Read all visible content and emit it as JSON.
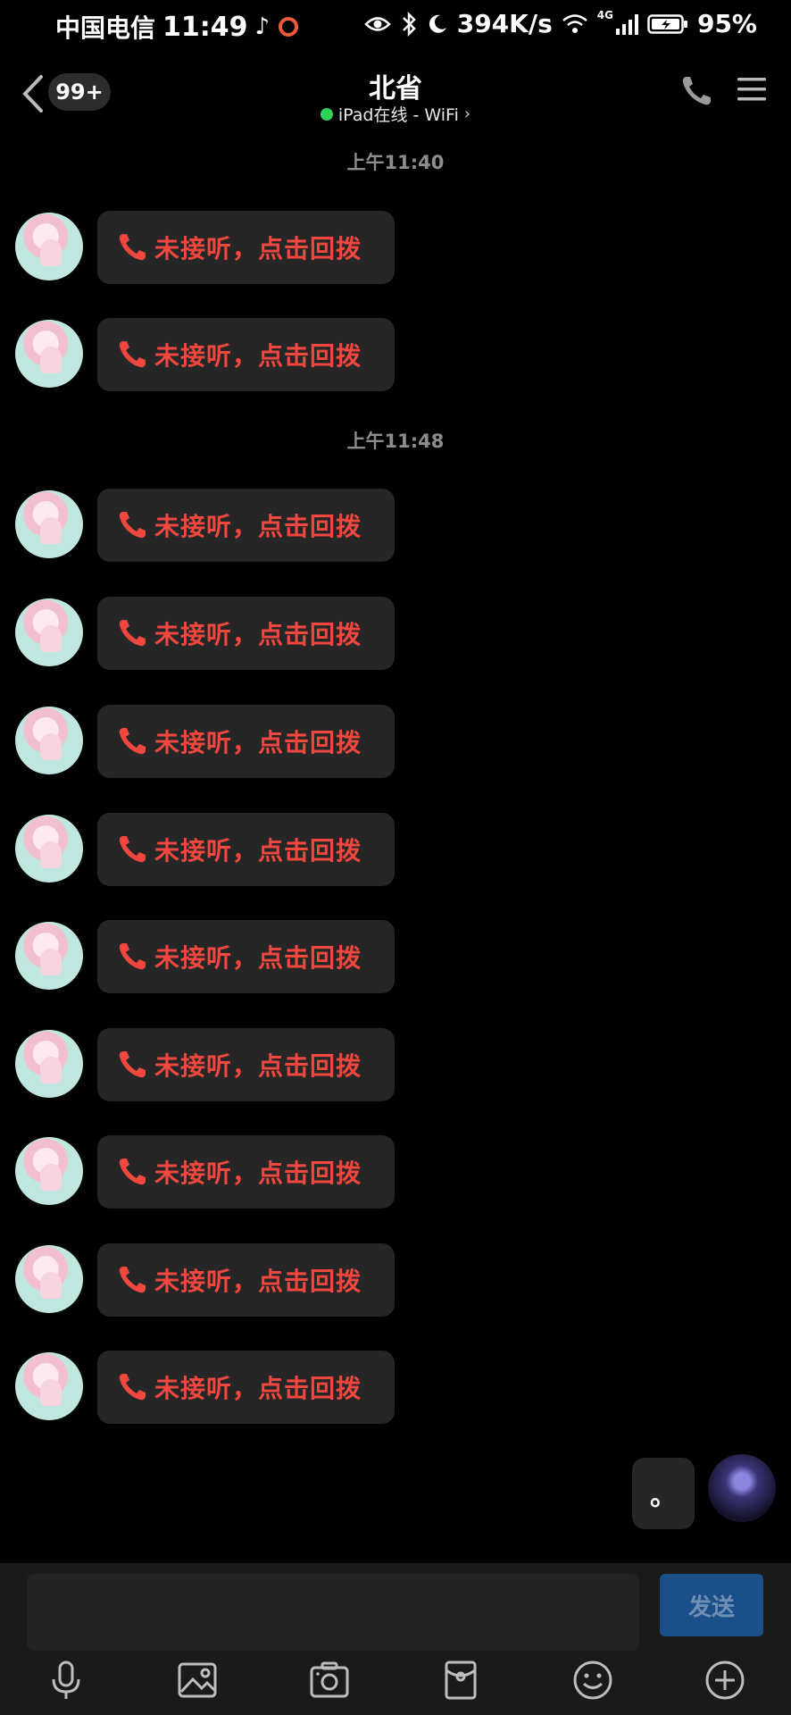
{
  "status_bar": {
    "carrier": "中国电信",
    "time": "11:49",
    "net_speed": "394K/s",
    "network": "4G",
    "battery": "95%",
    "icons": [
      "music-note-icon",
      "record-icon",
      "eye-icon",
      "bluetooth-icon",
      "moon-icon",
      "wifi-icon",
      "signal-icon",
      "battery-charging-icon"
    ]
  },
  "header": {
    "unread_badge": "99+",
    "title": "北省",
    "subtitle": "iPad在线 - WiFi",
    "subtitle_chevron": "›",
    "online_color": "#2fd15a"
  },
  "chat": {
    "sections": [
      {
        "timestamp": "上午11:40"
      },
      {
        "timestamp": "上午11:48"
      }
    ],
    "missed_call_text": "未接听，点击回拨",
    "missed_call_color": "#f0473e",
    "my_message": "。"
  },
  "composer": {
    "input_value": "",
    "send_label": "发送",
    "toolbar": [
      "microphone-icon",
      "image-icon",
      "camera-icon",
      "red-packet-icon",
      "emoji-icon",
      "plus-icon"
    ]
  }
}
